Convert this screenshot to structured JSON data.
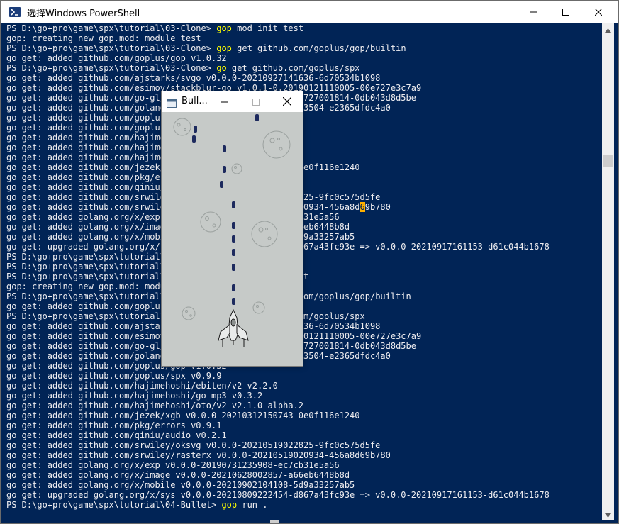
{
  "powershell": {
    "title": "选择Windows PowerShell",
    "lines": [
      {
        "text": "PS D:\\go+pro\\game\\spx\\tutorial\\03-Clone> ",
        "command": "gop",
        "rest": " mod init test"
      },
      {
        "text": "gop: creating new gop.mod: module test"
      },
      {
        "text": "PS D:\\go+pro\\game\\spx\\tutorial\\03-Clone> ",
        "command": "gop",
        "rest": " get github.com/goplus/gop/builtin"
      },
      {
        "text": "go get: added github.com/goplus/gop v1.0.32"
      },
      {
        "text": "PS D:\\go+pro\\game\\spx\\tutorial\\03-Clone> ",
        "command": "go",
        "rest": " get github.com/goplus/spx"
      },
      {
        "text": "go get: added github.com/ajstarks/svgo v0.0.0-20210927141636-6d70534b1098"
      },
      {
        "text": "go get: added github.com/esimov/stackblur-go v1.0.1-0.20190121110005-00e727e3c7a9"
      },
      {
        "text": "go get: added github.com/go-gl/glfw/v3.3/glfw v0.0.0-20210727001814-0db043d8d5be"
      },
      {
        "text": "go get: added github.com/golang/freetype v0.0.0-20170609003504-e2365dfdc4a0"
      },
      {
        "text": "go get: added github.com/goplus/gop v1.0.32"
      },
      {
        "text": "go get: added github.com/goplus/spx v0.9.9"
      },
      {
        "text": "go get: added github.com/hajimehoshi/ebiten/v2 v2.2.0"
      },
      {
        "text": "go get: added github.com/hajimehoshi/go-mp3 v0.3.2"
      },
      {
        "text": "go get: added github.com/hajimehoshi/oto/v2 v2.1.0-alpha.2"
      },
      {
        "text": "go get: added github.com/jezek/xgb v0.0.0-20210312150743-0e0f116e1240"
      },
      {
        "text": "go get: added github.com/pkg/errors v0.9.1"
      },
      {
        "text": "go get: added github.com/qiniu/audio v0.2.1"
      },
      {
        "text": "go get: added github.com/srwiley/oksvg v0.0.0-20210519022825-9fc0c575d5fe"
      },
      {
        "text": "go get: added github.com/srwiley/rasterx v0.0.0-20210519020934-456a8d",
        "cursor": "6",
        "after": "9b780"
      },
      {
        "text": "go get: added golang.org/x/exp v0.0.0-20190731235908-ec7cb31e5a56"
      },
      {
        "text": "go get: added golang.org/x/image v0.0.0-20210628002857-a66eb6448b8d"
      },
      {
        "text": "go get: added golang.org/x/mobile v0.0.0-20210902104108-5d9a33257ab5"
      },
      {
        "text": "go get: upgraded golang.org/x/sys v0.0.0-20210809222454-d867a43fc93e => v0.0.0-20210917161153-d61c044b1678"
      },
      {
        "text": "PS D:\\go+pro\\game\\spx\\tutorial\\03-Clone>"
      },
      {
        "text": "PS D:\\go+pro\\game\\spx\\tutorial\\03-Clone>"
      },
      {
        "text": "PS D:\\go+pro\\game\\spx\\tutorial\\04-Bullet> ",
        "command": "gop",
        "rest": " mod init test"
      },
      {
        "text": "gop: creating new gop.mod: module test"
      },
      {
        "text": "PS D:\\go+pro\\game\\spx\\tutorial\\04-Bullet> ",
        "command": "gop",
        "rest": " get github.com/goplus/gop/builtin"
      },
      {
        "text": "go get: added github.com/goplus/gop v1.0.32"
      },
      {
        "text": "PS D:\\go+pro\\game\\spx\\tutorial\\04-Bullet> ",
        "command": "go",
        "rest": " get github.com/goplus/spx"
      },
      {
        "text": "go get: added github.com/ajstarks/svgo v0.0.0-20210927141636-6d70534b1098"
      },
      {
        "text": "go get: added github.com/esimov/stackblur-go v1.0.1-0.20190121110005-00e727e3c7a9"
      },
      {
        "text": "go get: added github.com/go-gl/glfw/v3.3/glfw v0.0.0-20210727001814-0db043d8d5be"
      },
      {
        "text": "go get: added github.com/golang/freetype v0.0.0-20170609003504-e2365dfdc4a0"
      },
      {
        "text": "go get: added github.com/goplus/gop v1.0.32"
      },
      {
        "text": "go get: added github.com/goplus/spx v0.9.9"
      },
      {
        "text": "go get: added github.com/hajimehoshi/ebiten/v2 v2.2.0"
      },
      {
        "text": "go get: added github.com/hajimehoshi/go-mp3 v0.3.2"
      },
      {
        "text": "go get: added github.com/hajimehoshi/oto/v2 v2.1.0-alpha.2"
      },
      {
        "text": "go get: added github.com/jezek/xgb v0.0.0-20210312150743-0e0f116e1240"
      },
      {
        "text": "go get: added github.com/pkg/errors v0.9.1"
      },
      {
        "text": "go get: added github.com/qiniu/audio v0.2.1"
      },
      {
        "text": "go get: added github.com/srwiley/oksvg v0.0.0-20210519022825-9fc0c575d5fe"
      },
      {
        "text": "go get: added github.com/srwiley/rasterx v0.0.0-20210519020934-456a8d69b780"
      },
      {
        "text": "go get: added golang.org/x/exp v0.0.0-20190731235908-ec7cb31e5a56"
      },
      {
        "text": "go get: added golang.org/x/image v0.0.0-20210628002857-a66eb6448b8d"
      },
      {
        "text": "go get: added golang.org/x/mobile v0.0.0-20210902104108-5d9a33257ab5"
      },
      {
        "text": "go get: upgraded golang.org/x/sys v0.0.0-20210809222454-d867a43fc93e => v0.0.0-20210917161153-d61c044b1678"
      },
      {
        "text": "PS D:\\go+pro\\game\\spx\\tutorial\\04-Bullet> ",
        "command": "gop",
        "rest": " run ."
      }
    ]
  },
  "game_window": {
    "title": "Bull..."
  },
  "colors": {
    "console_bg": "#012456",
    "console_text": "#eeedf0",
    "command_text": "#ffff00",
    "cursor": "#ffb000",
    "game_bg": "#c6cac8",
    "bullet": "#1d2a5e"
  },
  "icons": {
    "ps_app": "powershell-icon",
    "minimize": "minimize-icon",
    "maximize": "maximize-icon",
    "close": "close-icon",
    "game_app": "game-app-icon",
    "scroll_up": "scroll-up-icon",
    "scroll_down": "scroll-down-icon"
  }
}
